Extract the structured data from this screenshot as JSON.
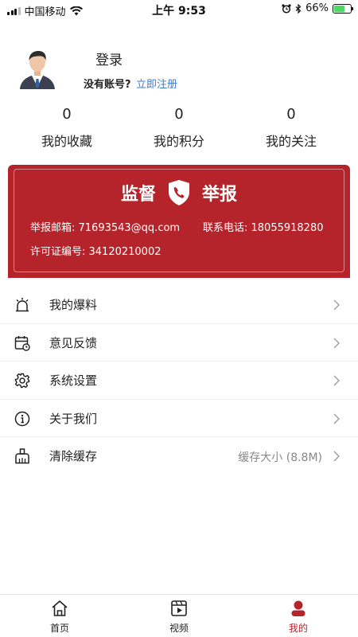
{
  "status_bar": {
    "carrier": "中国移动",
    "time": "上午 9:53",
    "battery": "66%",
    "battery_level": 0.66
  },
  "profile": {
    "login_label": "登录",
    "no_account_text": "没有账号?",
    "register_link": "立即注册"
  },
  "stats": [
    {
      "value": "0",
      "label": "我的收藏"
    },
    {
      "value": "0",
      "label": "我的积分"
    },
    {
      "value": "0",
      "label": "我的关注"
    }
  ],
  "banner": {
    "title_left": "监督",
    "title_right": "举报",
    "email": "举报邮箱: 71693543@qq.com",
    "phone": "联系电话: 18055918280",
    "license": "许可证编号: 34120210002"
  },
  "menu": [
    {
      "label": "我的爆料",
      "icon": "alarm-icon"
    },
    {
      "label": "意见反馈",
      "icon": "calendar-feedback-icon"
    },
    {
      "label": "系统设置",
      "icon": "gear-icon"
    },
    {
      "label": "关于我们",
      "icon": "info-icon"
    },
    {
      "label": "清除缓存",
      "icon": "broom-icon",
      "value": "缓存大小 (8.8M)"
    }
  ],
  "tabbar": [
    {
      "label": "首页",
      "icon": "home-icon",
      "active": false
    },
    {
      "label": "视频",
      "icon": "video-icon",
      "active": false
    },
    {
      "label": "我的",
      "icon": "user-icon",
      "active": true
    }
  ],
  "colors": {
    "accent": "#b5242b",
    "link": "#3a7bd5"
  }
}
